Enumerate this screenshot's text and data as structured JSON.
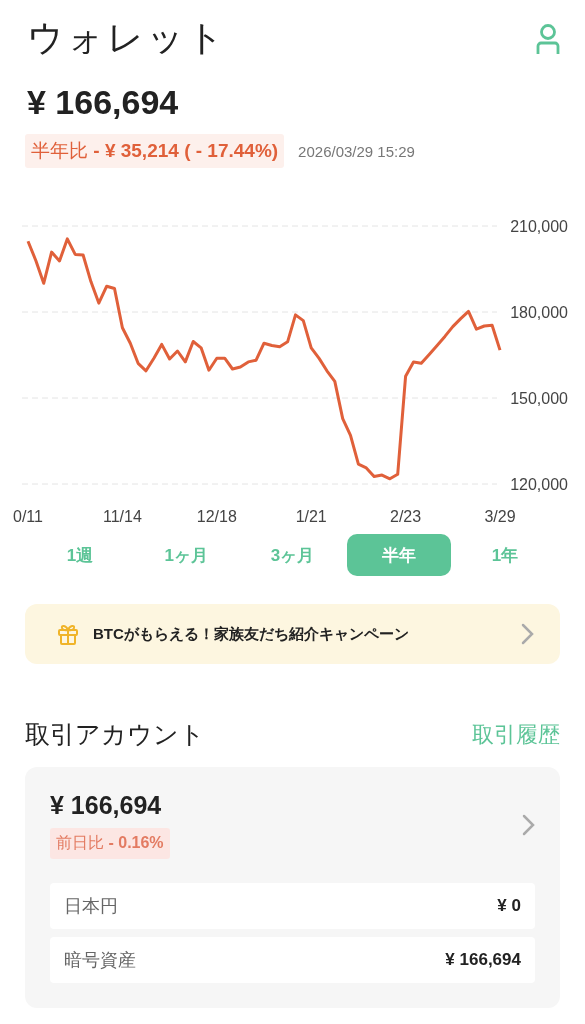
{
  "header": {
    "title": "ウォレット"
  },
  "balance": {
    "amount": "¥ 166,694",
    "change": "半年比 **- ¥ 35,214 ( - 17.44%)**",
    "timestamp": "2026/03/29 15:29"
  },
  "chart_data": {
    "type": "line",
    "ylim": [
      120000,
      210000
    ],
    "yticks": [
      {
        "value": 210000,
        "label": "210,000"
      },
      {
        "value": 180000,
        "label": "180,000"
      },
      {
        "value": 150000,
        "label": "150,000"
      },
      {
        "value": 120000,
        "label": "120,000"
      }
    ],
    "categories": [
      "0/11",
      null,
      null,
      null,
      null,
      null,
      null,
      null,
      null,
      null,
      null,
      null,
      "11/14",
      null,
      null,
      null,
      null,
      null,
      null,
      null,
      null,
      null,
      null,
      null,
      "12/18",
      null,
      null,
      null,
      null,
      null,
      null,
      null,
      null,
      null,
      null,
      null,
      "1/21",
      null,
      null,
      null,
      null,
      null,
      null,
      null,
      null,
      null,
      null,
      null,
      "2/23",
      null,
      null,
      null,
      null,
      null,
      null,
      null,
      null,
      null,
      null,
      null,
      "3/29"
    ],
    "series": [
      {
        "color": "#e0603a",
        "values": [
          204700,
          197900,
          190000,
          200900,
          197800,
          205500,
          200100,
          199900,
          190600,
          183100,
          189000,
          188200,
          174500,
          169100,
          162100,
          159500,
          163900,
          168700,
          163600,
          166400,
          162600,
          169700,
          167500,
          159700,
          163900,
          163900,
          160100,
          160800,
          162600,
          163200,
          169100,
          168300,
          167900,
          169600,
          179000,
          177000,
          167500,
          163800,
          159500,
          155800,
          142800,
          137000,
          126900,
          125600,
          122600,
          123100,
          121800,
          123400,
          157600,
          162600,
          162100,
          165200,
          168300,
          171500,
          174900,
          177700,
          180200,
          174000,
          175100,
          175400,
          166700
        ]
      }
    ]
  },
  "periods": [
    {
      "label": "1週",
      "selected": false
    },
    {
      "label": "1ヶ月",
      "selected": false
    },
    {
      "label": "3ヶ月",
      "selected": false
    },
    {
      "label": "半年",
      "selected": true
    },
    {
      "label": "1年",
      "selected": false
    }
  ],
  "banner": {
    "text": "BTCがもらえる！家族友だち紹介キャンペーン"
  },
  "account_section": {
    "title": "取引アカウント",
    "link": "取引履歴",
    "total": "¥ 166,694",
    "change": "前日比 **- 0.16%**",
    "rows": [
      {
        "label": "日本円",
        "value": "¥ 0"
      },
      {
        "label": "暗号資産",
        "value": "¥ 166,694"
      }
    ]
  }
}
